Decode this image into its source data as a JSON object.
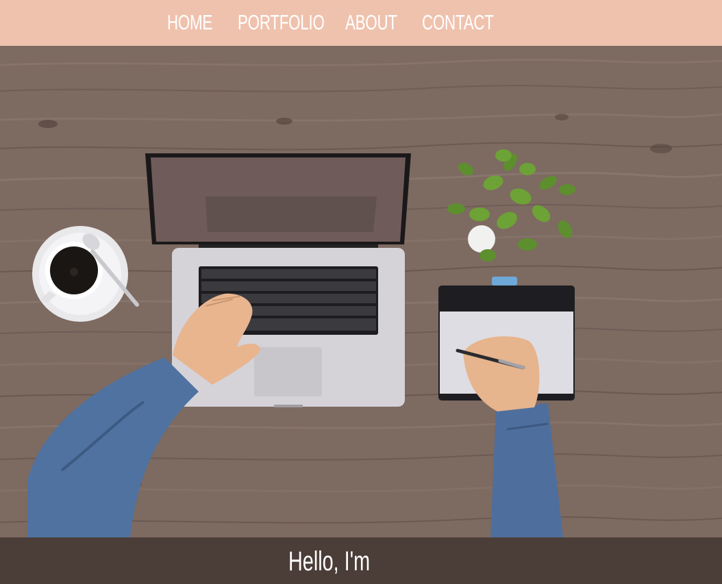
{
  "nav": {
    "items": [
      {
        "label": "HOME"
      },
      {
        "label": "PORTFOLIO"
      },
      {
        "label": "ABOUT"
      },
      {
        "label": "CONTACT"
      }
    ]
  },
  "hero": {
    "image": "desk-workspace-photo"
  },
  "intro": {
    "greeting": "Hello, I'm"
  },
  "colors": {
    "nav_bg": "#efc2ae",
    "nav_text": "#ffffff",
    "intro_bg": "#4b3d37",
    "wood": "#7d6a61"
  }
}
